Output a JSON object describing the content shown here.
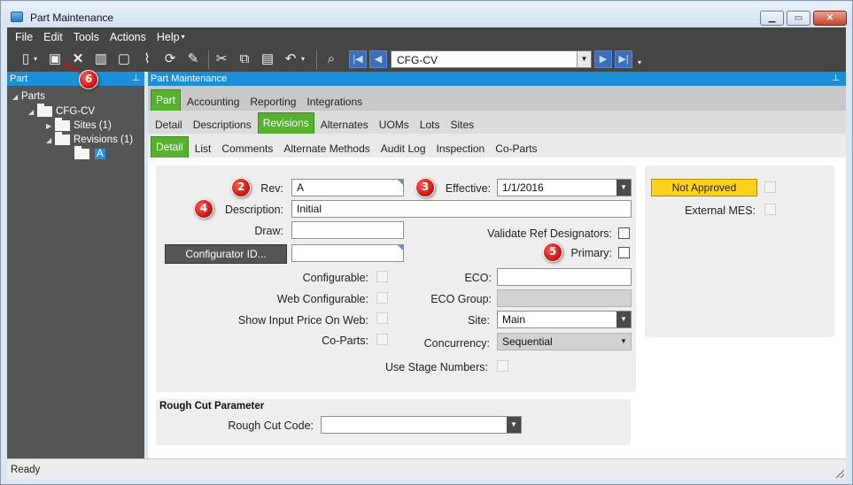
{
  "window": {
    "title": "Part Maintenance"
  },
  "menu": [
    "File",
    "Edit",
    "Tools",
    "Actions",
    "Help"
  ],
  "toolbar": {
    "icons": [
      "new-icon",
      "save-icon",
      "delete-icon",
      "book-icon",
      "note-icon",
      "attach-icon",
      "refresh-icon",
      "clear-icon",
      "cut-icon",
      "copy-icon",
      "paste-icon",
      "undo-icon",
      "search-icon",
      "first-record-icon",
      "prev-record-icon",
      "next-record-icon",
      "last-record-icon"
    ],
    "record_value": "CFG-CV"
  },
  "left_panel": {
    "title": "Part",
    "tree": {
      "root": "Parts",
      "part": "CFG-CV",
      "sites": "Sites (1)",
      "revisions": "Revisions (1)",
      "revision_item": "A"
    }
  },
  "main_panel": {
    "title": "Part Maintenance"
  },
  "tabs_level1": [
    "Part",
    "Accounting",
    "Reporting",
    "Integrations"
  ],
  "tabs_level2": [
    "Detail",
    "Descriptions",
    "Revisions",
    "Alternates",
    "UOMs",
    "Lots",
    "Sites"
  ],
  "tabs_level3": [
    "Detail",
    "List",
    "Comments",
    "Alternate Methods",
    "Audit Log",
    "Inspection",
    "Co-Parts"
  ],
  "form": {
    "rev_label": "Rev:",
    "rev_value": "A",
    "effective_label": "Effective:",
    "effective_value": "1/1/2016",
    "description_label": "Description:",
    "description_value": "Initial",
    "draw_label": "Draw:",
    "draw_value": "",
    "validate_label": "Validate Ref Designators:",
    "configurator_button": "Configurator ID...",
    "configurator_value": "",
    "primary_label": "Primary:",
    "configurable_label": "Configurable:",
    "web_configurable_label": "Web Configurable:",
    "show_price_label": "Show Input Price On Web:",
    "co_parts_label": "Co-Parts:",
    "eco_label": "ECO:",
    "eco_value": "",
    "eco_group_label": "ECO Group:",
    "eco_group_value": "",
    "site_label": "Site:",
    "site_value": "Main",
    "concurrency_label": "Concurrency:",
    "concurrency_value": "Sequential",
    "use_stage_label": "Use Stage Numbers:"
  },
  "status_group": {
    "not_approved": "Not Approved",
    "external_mes_label": "External MES:"
  },
  "rough_cut": {
    "title": "Rough Cut Parameter",
    "code_label": "Rough Cut Code:",
    "code_value": ""
  },
  "callouts": [
    "2",
    "3",
    "4",
    "5",
    "6"
  ],
  "status_bar": {
    "text": "Ready"
  },
  "colors": {
    "header_blue": "#1b8fd8",
    "active_tab_green": "#58b030",
    "not_approved_yellow": "#ffd11a",
    "callout_red": "#c81111",
    "dark_bar": "#454545"
  }
}
